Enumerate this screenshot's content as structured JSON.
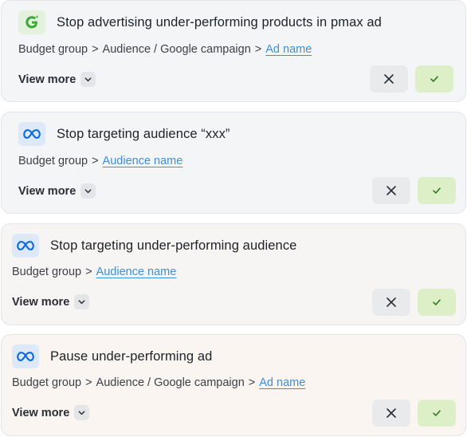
{
  "cards": [
    {
      "platform_icon": "google-ads-icon",
      "title": "Stop advertising under-performing products in pmax ad",
      "crumb_1": "Budget group",
      "sep_1": ">",
      "crumb_2": "Audience / Google campaign",
      "sep_2": ">",
      "link": "Ad name",
      "view_more": "View more"
    },
    {
      "platform_icon": "meta-icon",
      "title": "Stop targeting audience “xxx”",
      "crumb_1": "Budget group",
      "sep_1": ">",
      "link": "Audience name",
      "view_more": "View more"
    },
    {
      "platform_icon": "meta-icon",
      "title": "Stop targeting under-performing audience",
      "crumb_1": "Budget group",
      "sep_1": ">",
      "link": "Audience name",
      "view_more": "View more"
    },
    {
      "platform_icon": "meta-icon",
      "title": "Pause under-performing ad",
      "crumb_1": "Budget group",
      "sep_1": ">",
      "crumb_2": "Audience / Google campaign",
      "sep_2": ">",
      "link": "Ad name",
      "view_more": "View more"
    }
  ],
  "colors": {
    "link": "#3d8fd9",
    "accept_bg": "#dcefc7",
    "accept_check": "#2f7a1c",
    "google_green": "#3aa935",
    "meta_blue": "#0668e1"
  }
}
